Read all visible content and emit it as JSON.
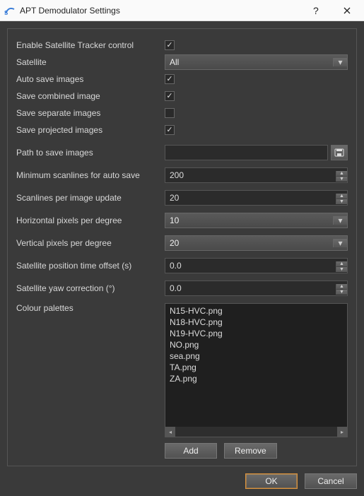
{
  "window": {
    "title": "APT Demodulator Settings"
  },
  "fields": {
    "enable_tracker": {
      "label": "Enable Satellite Tracker control",
      "checked": true
    },
    "satellite": {
      "label": "Satellite",
      "value": "All"
    },
    "auto_save": {
      "label": "Auto save images",
      "checked": true
    },
    "save_combined": {
      "label": "Save combined image",
      "checked": true
    },
    "save_separate": {
      "label": "Save separate images",
      "checked": false
    },
    "save_projected": {
      "label": "Save projected images",
      "checked": true
    },
    "path": {
      "label": "Path to save images",
      "value": ""
    },
    "min_scanlines": {
      "label": "Minimum scanlines for auto save",
      "value": "200"
    },
    "scan_per_update": {
      "label": "Scanlines per image update",
      "value": "20"
    },
    "hpix": {
      "label": "Horizontal pixels per degree",
      "value": "10"
    },
    "vpix": {
      "label": "Vertical pixels per degree",
      "value": "20"
    },
    "time_offset": {
      "label": "Satellite position time offset (s)",
      "value": "0.0"
    },
    "yaw": {
      "label": "Satellite yaw correction (°)",
      "value": "0.0"
    },
    "palettes": {
      "label": "Colour palettes"
    }
  },
  "palette_items": [
    "N15-HVC.png",
    "N18-HVC.png",
    "N19-HVC.png",
    "NO.png",
    "sea.png",
    "TA.png",
    "ZA.png"
  ],
  "buttons": {
    "add": "Add",
    "remove": "Remove",
    "ok": "OK",
    "cancel": "Cancel"
  }
}
